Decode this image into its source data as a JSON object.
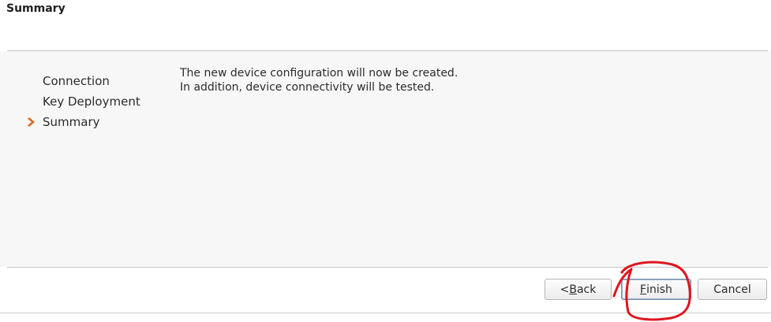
{
  "header": {
    "title": "Summary"
  },
  "steps": [
    {
      "label": "Connection",
      "current": false
    },
    {
      "label": "Key Deployment",
      "current": false
    },
    {
      "label": "Summary",
      "current": true
    }
  ],
  "message": {
    "line1": "The new device configuration will now be created.",
    "line2": "In addition, device connectivity will be tested."
  },
  "buttons": {
    "back": {
      "prefix": "< ",
      "mnemonic": "B",
      "rest": "ack"
    },
    "finish": {
      "prefix": "",
      "mnemonic": "F",
      "rest": "inish"
    },
    "cancel": {
      "label": "Cancel"
    }
  },
  "colors": {
    "current_step_arrow": "#e06a1c",
    "annotation_ink": "#e0141e"
  },
  "icons": {
    "current_step": "chevron-right-icon"
  }
}
